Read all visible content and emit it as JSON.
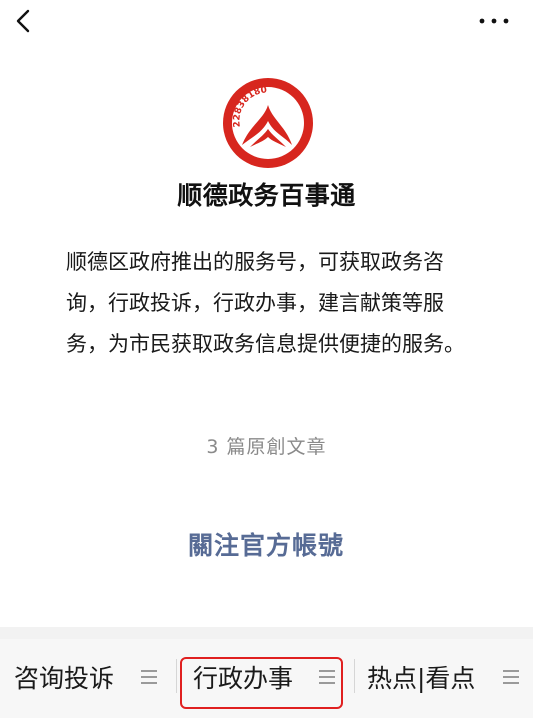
{
  "account": {
    "name": "顺德政务百事通",
    "description": "顺德区政府推出的服务号，可获取政务咨询，行政投诉，行政办事，建言献策等服务，为市民获取政务信息提供便捷的服务。",
    "original_articles": "3 篇原創文章",
    "follow_label": "關注官方帳號",
    "logo_number": "22838180"
  },
  "menu": {
    "items": [
      {
        "label": "咨询投诉"
      },
      {
        "label": "行政办事"
      },
      {
        "label": "热点|看点"
      }
    ]
  },
  "colors": {
    "logo_red": "#d7261e",
    "link_blue": "#576b95",
    "highlight_red": "#e02020"
  },
  "icons": {
    "back": "chevron-left-icon",
    "more": "more-dots-icon",
    "menu": "menu-lines-icon"
  }
}
